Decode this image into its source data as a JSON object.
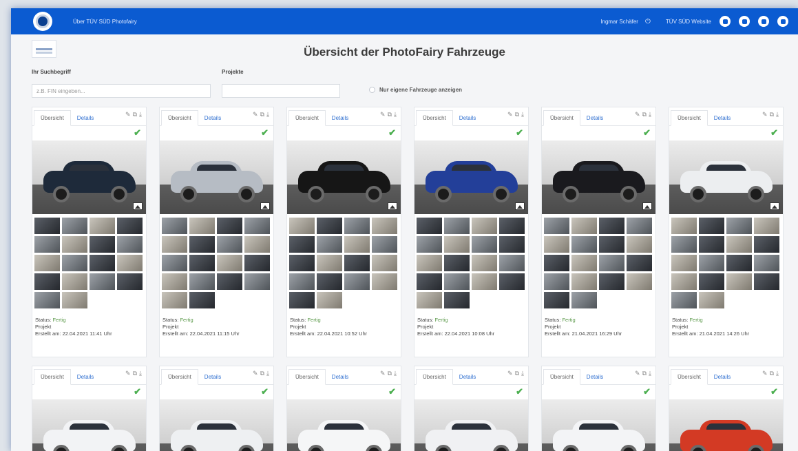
{
  "header": {
    "brand_link": "Über TÜV SÜD Photofairy",
    "user_name": "Ingmar Schäfer",
    "website_link": "TÜV SÜD Website",
    "social_icons": [
      "twitter-icon",
      "youtube-icon",
      "linkedin-icon",
      "instagram-icon"
    ],
    "color": "#0b5bd1"
  },
  "page": {
    "title": "Übersicht der PhotoFairy Fahrzeuge"
  },
  "filters": {
    "search_label": "Ihr Suchbegriff",
    "search_placeholder": "z.B. FIN eingeben...",
    "project_label": "Projekte",
    "project_value": "",
    "own_only_label": "Nur eigene Fahrzeuge anzeigen"
  },
  "card_labels": {
    "tab_overview": "Übersicht",
    "tab_details": "Details",
    "status_prefix": "Status:",
    "project_label": "Projekt",
    "created_prefix": "Erstellt am:"
  },
  "cards": [
    {
      "status": "Fertig",
      "created": "22.04.2021 11:41 Uhr",
      "car_color": "#1e2a3a",
      "thumb_rows": 5
    },
    {
      "status": "Fertig",
      "created": "22.04.2021 11:15 Uhr",
      "car_color": "#b6bcc4",
      "thumb_rows": 5
    },
    {
      "status": "Fertig",
      "created": "22.04.2021 10:52 Uhr",
      "car_color": "#161616",
      "thumb_rows": 5
    },
    {
      "status": "Fertig",
      "created": "22.04.2021 10:08 Uhr",
      "car_color": "#233f99",
      "thumb_rows": 5
    },
    {
      "status": "Fertig",
      "created": "21.04.2021 16:29 Uhr",
      "car_color": "#1a1a1e",
      "thumb_rows": 5
    },
    {
      "status": "Fertig",
      "created": "21.04.2021 14:26 Uhr",
      "car_color": "#eceef0",
      "thumb_rows": 5
    },
    {
      "car_color": "#f2f3f5"
    },
    {
      "car_color": "#eef0f2"
    },
    {
      "car_color": "#f5f6f7"
    },
    {
      "car_color": "#f0f1f3"
    },
    {
      "car_color": "#f3f4f6"
    },
    {
      "car_color": "#d33a24"
    }
  ]
}
